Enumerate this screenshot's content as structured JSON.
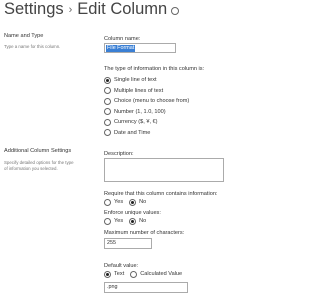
{
  "header": {
    "title": "Settings",
    "separator": "›",
    "subtitle": "Edit Column"
  },
  "name_type_section": {
    "title": "Name and Type",
    "description": "Type a name for this column."
  },
  "column_name": {
    "label": "Column name:",
    "value": "File Format"
  },
  "type_group": {
    "label": "The type of information in this column is:",
    "options": [
      {
        "label": "Single line of text",
        "checked": true
      },
      {
        "label": "Multiple lines of text",
        "checked": false
      },
      {
        "label": "Choice (menu to choose from)",
        "checked": false
      },
      {
        "label": "Number (1, 1.0, 100)",
        "checked": false
      },
      {
        "label": "Currency ($, ¥, €)",
        "checked": false
      },
      {
        "label": "Date and Time",
        "checked": false
      }
    ]
  },
  "additional_section": {
    "title": "Additional Column Settings",
    "description": "Specify detailed options for the type of information you selected."
  },
  "description_field": {
    "label": "Description:"
  },
  "required": {
    "label": "Require that this column contains information:",
    "yes": "Yes",
    "no": "No",
    "selected": "No"
  },
  "unique": {
    "label": "Enforce unique values:",
    "yes": "Yes",
    "no": "No",
    "selected": "No"
  },
  "max_chars": {
    "label": "Maximum number of characters:",
    "value": "255"
  },
  "default_value": {
    "label": "Default value:",
    "text_option": "Text",
    "calc_option": "Calculated Value",
    "selected": "Text",
    "value": ".png"
  }
}
